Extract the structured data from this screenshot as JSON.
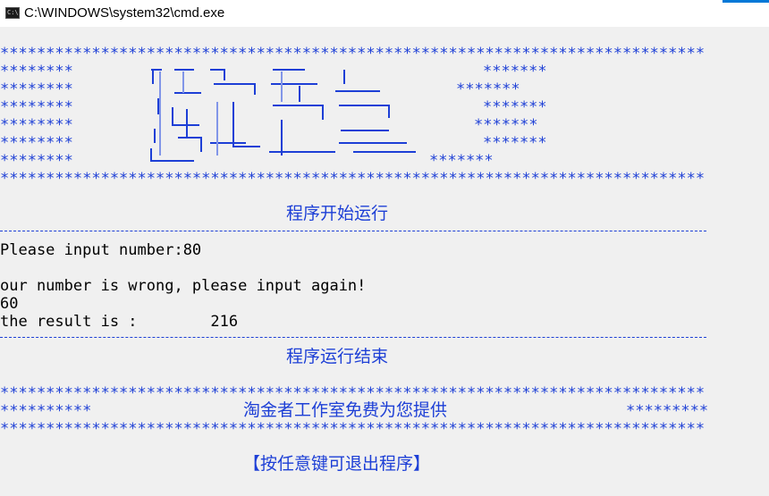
{
  "window": {
    "title": "C:\\WINDOWS\\system32\\cmd.exe",
    "icon_label": "C:\\."
  },
  "banner": {
    "border": "*****************************************************************************",
    "left_block": "********",
    "right_blocks": [
      "*******",
      "*******",
      "*******",
      "*******",
      "*******",
      "*******"
    ]
  },
  "program": {
    "start_text": "程序开始运行",
    "divider": "-------------------------------------------------------------------------------",
    "prompt": "Please input number:80",
    "error": "our number is wrong, please input again!",
    "second_input": "60",
    "result": "the result is :        216",
    "end_text": "程序运行结束"
  },
  "footer": {
    "border": "*****************************************************************************",
    "left_stars": "**********",
    "message": "淘金者工作室免费为您提供",
    "right_stars": "*********",
    "exit_prompt": "【按任意键可退出程序】"
  },
  "colors": {
    "console_bg": "#f0f0f0",
    "text": "#000000",
    "accent": "#1d3fd6"
  }
}
